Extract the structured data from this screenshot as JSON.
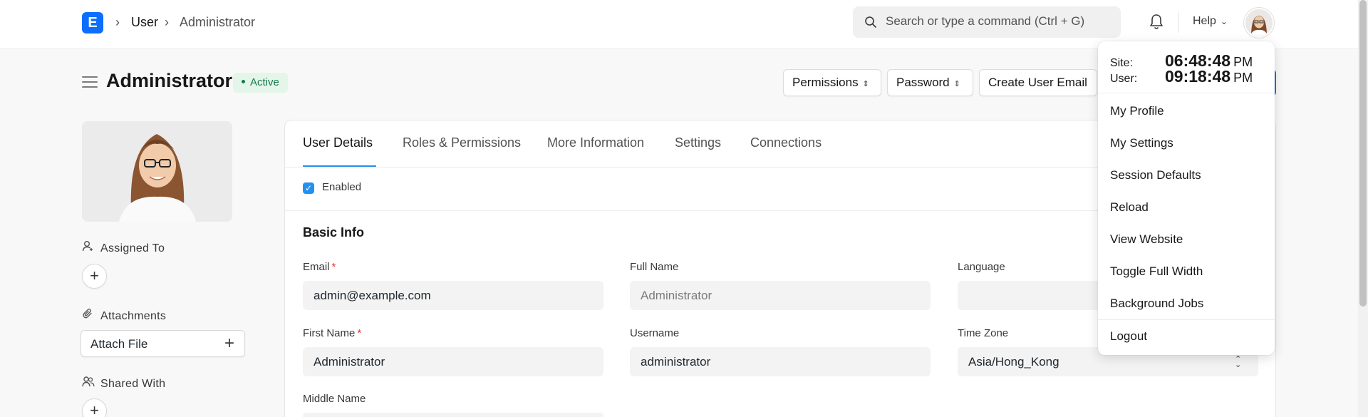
{
  "navbar": {
    "logo": "E",
    "breadcrumb": [
      "User",
      "Administrator"
    ],
    "search_placeholder": "Search or type a command (Ctrl + G)",
    "help_label": "Help"
  },
  "header": {
    "title": "Administrator",
    "status": "Active",
    "buttons": [
      "Permissions",
      "Password",
      "Create User Email"
    ]
  },
  "sidebar": {
    "assigned_to": "Assigned To",
    "attachments": "Attachments",
    "attach_file": "Attach File",
    "shared_with": "Shared With"
  },
  "tabs": [
    "User Details",
    "Roles & Permissions",
    "More Information",
    "Settings",
    "Connections"
  ],
  "form": {
    "enabled_label": "Enabled",
    "enabled": true,
    "section_title": "Basic Info",
    "email_label": "Email",
    "email": "admin@example.com",
    "full_name_label": "Full Name",
    "full_name": "Administrator",
    "language_label": "Language",
    "language": "",
    "first_name_label": "First Name",
    "first_name": "Administrator",
    "username_label": "Username",
    "username": "administrator",
    "time_zone_label": "Time Zone",
    "time_zone": "Asia/Hong_Kong",
    "middle_name_label": "Middle Name"
  },
  "dropdown": {
    "site_label": "Site:",
    "site_time": "06:48:48",
    "site_ampm": "PM",
    "user_label": "User:",
    "user_time": "09:18:48",
    "user_ampm": "PM",
    "items": [
      "My Profile",
      "My Settings",
      "Session Defaults",
      "Reload",
      "View Website",
      "Toggle Full Width",
      "Background Jobs",
      "Logout"
    ]
  },
  "colors": {
    "primary": "#2490ef",
    "logo": "#0d6efd",
    "success_bg": "#e4f5e9",
    "success_text": "#16794c",
    "required": "#e03636"
  }
}
